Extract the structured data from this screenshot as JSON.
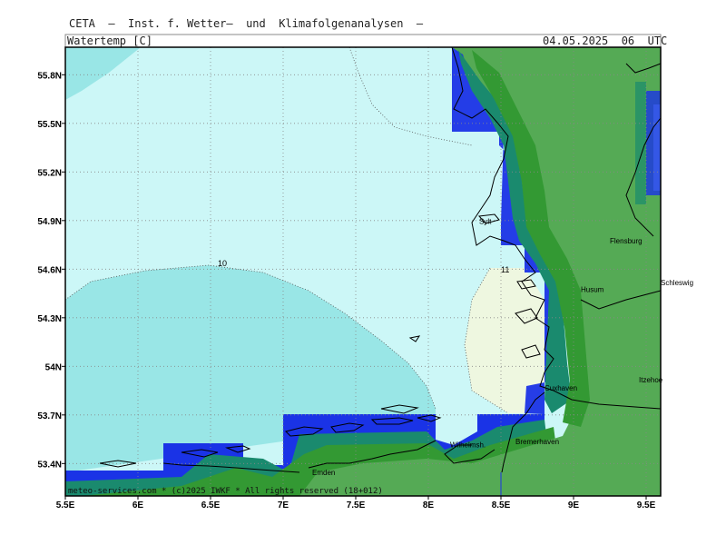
{
  "header": {
    "institute": "CETA  –  Inst. f. Wetter–  und  Klimafolgenanalysen  –",
    "variable": "Watertemp [C]",
    "datetime": "04.05.2025  06  UTC"
  },
  "footer": "meteo-services.com * (c)2025 IWKF * All rights reserved (18+012)",
  "axes": {
    "x_ticks": [
      "5.5E",
      "6E",
      "6.5E",
      "7E",
      "7.5E",
      "8E",
      "8.5E",
      "9E",
      "9.5E"
    ],
    "y_ticks": [
      "55.8N",
      "55.5N",
      "55.2N",
      "54.9N",
      "54.6N",
      "54.3N",
      "54N",
      "53.7N",
      "53.4N"
    ]
  },
  "contour_labels": [
    {
      "text": "10",
      "lon": 6.55,
      "lat": 54.62
    },
    {
      "text": "11",
      "lon": 8.5,
      "lat": 54.58
    }
  ],
  "cities": [
    {
      "name": "Flensburg",
      "lon": 9.25,
      "lat": 54.76
    },
    {
      "name": "Schleswig",
      "lon": 9.6,
      "lat": 54.5
    },
    {
      "name": "Husum",
      "lon": 9.05,
      "lat": 54.46
    },
    {
      "name": "Itzehoe",
      "lon": 9.45,
      "lat": 53.9
    },
    {
      "name": "Cuxhaven",
      "lon": 8.8,
      "lat": 53.85
    },
    {
      "name": "Bremerhaven",
      "lon": 8.6,
      "lat": 53.52
    },
    {
      "name": "Wilhelmsh.",
      "lon": 8.15,
      "lat": 53.5
    },
    {
      "name": "Emden",
      "lon": 7.2,
      "lat": 53.33
    },
    {
      "name": "Sylt",
      "lon": 8.35,
      "lat": 54.88
    }
  ],
  "colors": {
    "land": "#55aa55",
    "coast_dark": "#339933",
    "coast_teal": "#1a8a6e",
    "blue": "#1a33e6",
    "cyan_light": "#ccf7f7",
    "cyan_mid": "#99e6e6",
    "warm": "#eef7e0"
  }
}
